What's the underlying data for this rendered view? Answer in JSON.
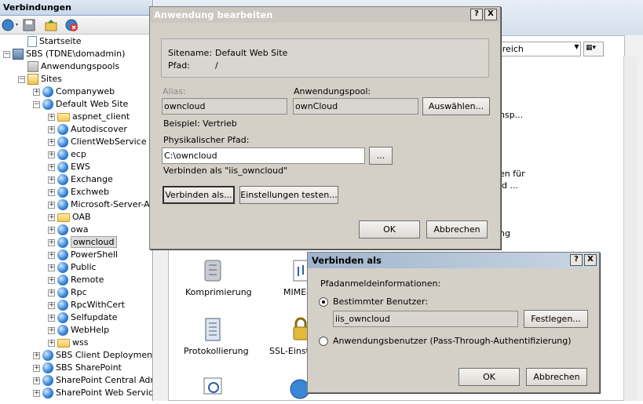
{
  "connections": {
    "title": "Verbindungen",
    "tree": [
      {
        "label": "Startseite",
        "level": 1,
        "icon": "home-icon",
        "expander": ""
      },
      {
        "label": "SBS (TDNE\\domadmin)",
        "level": 0,
        "icon": "server-icon",
        "expander": "−"
      },
      {
        "label": "Anwendungspools",
        "level": 1,
        "icon": "app-pools-icon",
        "expander": ""
      },
      {
        "label": "Sites",
        "level": 1,
        "icon": "sites-icon",
        "expander": "−"
      },
      {
        "label": "Companyweb",
        "level": 2,
        "icon": "globe-icon",
        "expander": "+"
      },
      {
        "label": "Default Web Site",
        "level": 2,
        "icon": "globe-icon",
        "expander": "−"
      },
      {
        "label": "aspnet_client",
        "level": 3,
        "icon": "folder-icon",
        "expander": "+"
      },
      {
        "label": "Autodiscover",
        "level": 3,
        "icon": "app-icon",
        "expander": "+"
      },
      {
        "label": "ClientWebService",
        "level": 3,
        "icon": "app-icon",
        "expander": "+"
      },
      {
        "label": "ecp",
        "level": 3,
        "icon": "app-icon",
        "expander": "+"
      },
      {
        "label": "EWS",
        "level": 3,
        "icon": "app-icon",
        "expander": "+"
      },
      {
        "label": "Exchange",
        "level": 3,
        "icon": "app-icon",
        "expander": "+"
      },
      {
        "label": "Exchweb",
        "level": 3,
        "icon": "app-icon",
        "expander": "+"
      },
      {
        "label": "Microsoft-Server-Ac",
        "level": 3,
        "icon": "app-icon",
        "expander": "+"
      },
      {
        "label": "OAB",
        "level": 3,
        "icon": "folder-icon",
        "expander": "+"
      },
      {
        "label": "owa",
        "level": 3,
        "icon": "app-icon",
        "expander": "+"
      },
      {
        "label": "owncloud",
        "level": 3,
        "icon": "app-icon",
        "expander": "+",
        "selected": true
      },
      {
        "label": "PowerShell",
        "level": 3,
        "icon": "app-icon",
        "expander": "+"
      },
      {
        "label": "Public",
        "level": 3,
        "icon": "app-icon",
        "expander": "+"
      },
      {
        "label": "Remote",
        "level": 3,
        "icon": "app-icon",
        "expander": "+"
      },
      {
        "label": "Rpc",
        "level": 3,
        "icon": "app-icon",
        "expander": "+"
      },
      {
        "label": "RpcWithCert",
        "level": 3,
        "icon": "app-icon",
        "expander": "+"
      },
      {
        "label": "Selfupdate",
        "level": 3,
        "icon": "app-icon",
        "expander": "+"
      },
      {
        "label": "WebHelp",
        "level": 3,
        "icon": "app-icon",
        "expander": "+"
      },
      {
        "label": "wss",
        "level": 3,
        "icon": "folder-icon",
        "expander": "+"
      },
      {
        "label": "SBS Client Deployment A",
        "level": 2,
        "icon": "globe-icon",
        "expander": "+"
      },
      {
        "label": "SBS SharePoint",
        "level": 2,
        "icon": "globe-icon",
        "expander": "+"
      },
      {
        "label": "SharePoint Central Admin",
        "level": 2,
        "icon": "globe-icon",
        "expander": "+"
      },
      {
        "label": "SharePoint Web Services",
        "level": 2,
        "icon": "globe-icon",
        "expander": "+"
      }
    ]
  },
  "background": {
    "group_by": "ereich",
    "snippets": [
      "nsp...",
      "en für",
      "id ...",
      "ng"
    ],
    "features": [
      {
        "label": "Komprimierung",
        "icon": "compression-icon"
      },
      {
        "label": "MIME-",
        "icon": "mime-icon"
      },
      {
        "label": "Protokollierung",
        "icon": "logging-icon"
      },
      {
        "label": "SSL-Einste",
        "icon": "ssl-lock-icon"
      }
    ]
  },
  "edit_dialog": {
    "title": "Anwendung bearbeiten",
    "sitename_label": "Sitename:",
    "sitename_value": "Default Web Site",
    "path_label": "Pfad:",
    "path_value": "/",
    "alias_label": "Alias:",
    "alias_value": "owncloud",
    "pool_label": "Anwendungspool:",
    "pool_value": "ownCloud",
    "select_button": "Auswählen...",
    "example_text": "Beispiel: Vertrieb",
    "physical_path_label": "Physikalischer Pfad:",
    "physical_path_value": "C:\\owncloud",
    "browse_button": "...",
    "connect_as_text": "Verbinden als \"iis_owncloud\"",
    "connect_as_button": "Verbinden als...",
    "test_settings_button": "Einstellungen testen...",
    "ok_button": "OK",
    "cancel_button": "Abbrechen",
    "help_button": "?",
    "close_button": "X"
  },
  "connect_dialog": {
    "title": "Verbinden als",
    "credentials_label": "Pfadanmeldeinformationen:",
    "specific_user_label": "Bestimmter Benutzer:",
    "specific_user_value": "iis_owncloud",
    "set_button": "Festlegen...",
    "app_user_label": "Anwendungsbenutzer (Pass-Through-Authentifizierung)",
    "selected_option": "specific_user",
    "ok_button": "OK",
    "cancel_button": "Abbrechen",
    "help_button": "?",
    "close_button": "X"
  }
}
